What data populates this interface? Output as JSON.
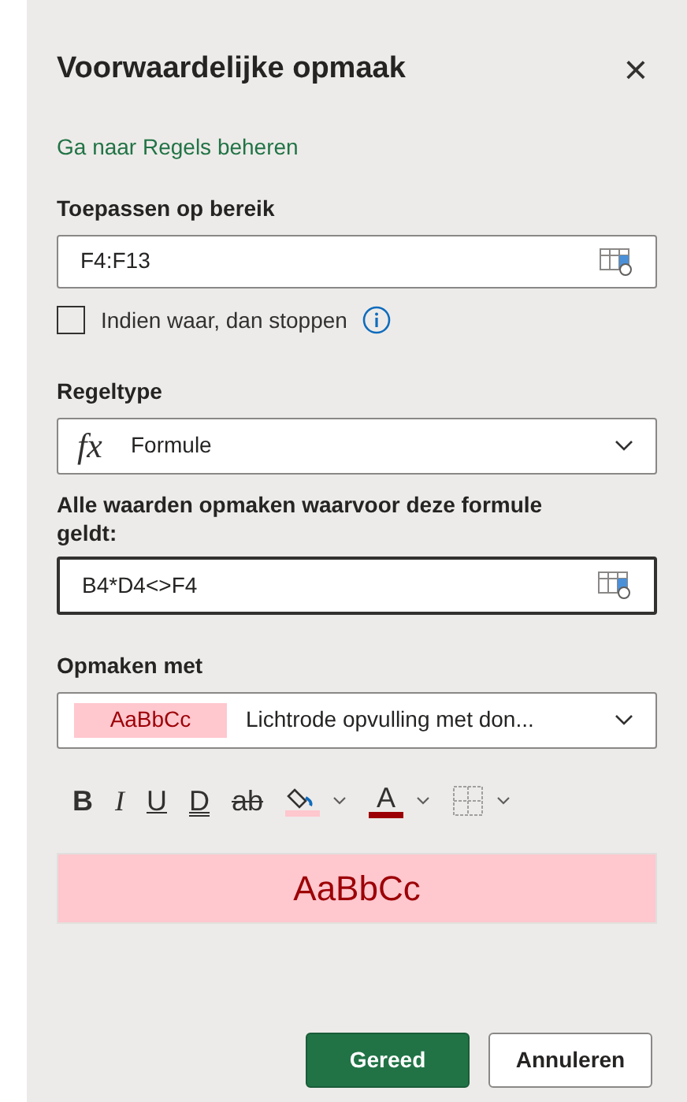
{
  "panel": {
    "title": "Voorwaardelijke opmaak",
    "close": "×"
  },
  "manage_link": "Ga naar Regels beheren",
  "range": {
    "label": "Toepassen op bereik",
    "value": "F4:F13"
  },
  "stop_if_true": {
    "label": "Indien waar, dan stoppen",
    "checked": false
  },
  "rule_type": {
    "label": "Regeltype",
    "icon": "fx",
    "value": "Formule"
  },
  "formula": {
    "label": "Alle waarden opmaken waarvoor deze formule geldt:",
    "value": "B4*D4<>F4"
  },
  "format_with": {
    "label": "Opmaken met",
    "sample": "AaBbCc",
    "value": "Lichtrode opvulling met don..."
  },
  "formatting_buttons": [
    {
      "kind": "bold",
      "label": "B"
    },
    {
      "kind": "italic",
      "label": "I"
    },
    {
      "kind": "underline",
      "label": "U"
    },
    {
      "kind": "double_underline",
      "label": "D"
    },
    {
      "kind": "strikethrough",
      "label": "ab"
    },
    {
      "kind": "fill_color",
      "color": "#ffc7ce"
    },
    {
      "kind": "font_color",
      "label": "A",
      "color": "#9c0006"
    },
    {
      "kind": "borders"
    }
  ],
  "preview": {
    "text": "AaBbCc",
    "color": "#ffc7ce"
  },
  "buttons": [
    {
      "label": "Gereed",
      "kind": "primary"
    },
    {
      "label": "Annuleren",
      "kind": "secondary"
    }
  ]
}
